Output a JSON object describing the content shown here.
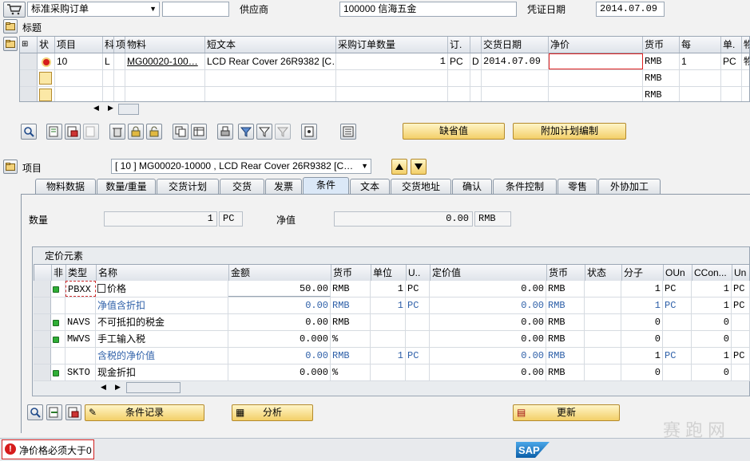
{
  "header": {
    "doc_type": "标准采购订单",
    "supplier_label": "供应商",
    "supplier_value": "100000 信海五金",
    "doc_date_label": "凭证日期",
    "doc_date_value": "2014.07.09"
  },
  "sections": {
    "header_label": "标题",
    "item_label": "项目"
  },
  "items_table": {
    "columns": [
      "状",
      "项目",
      "科",
      "项",
      "物料",
      "短文本",
      "采购订单数量",
      "订.",
      "",
      "交货日期",
      "净价",
      "货币",
      "每",
      "单.",
      "物"
    ],
    "row1": {
      "item": "10",
      "acct": "L",
      "material": "MG00020-100…",
      "short_text": "LCD Rear Cover 26R9382 [C…",
      "qty": "1",
      "unit": "PC",
      "cat": "D",
      "date": "2014.07.09",
      "price": "",
      "currency": "RMB",
      "per": "1",
      "order_unit": "PC",
      "mat_grp": "物"
    },
    "row2": {
      "currency": "RMB"
    },
    "row3": {
      "currency": "RMB"
    }
  },
  "item_buttons": {
    "default_values": "缺省值",
    "additional_planning": "附加计划编制"
  },
  "item_selector": {
    "value": "[ 10 ] MG00020-10000 , LCD Rear Cover 26R9382 [C…"
  },
  "tabs": [
    "物料数据",
    "数量/重量",
    "交货计划",
    "交货",
    "发票",
    "条件",
    "文本",
    "交货地址",
    "确认",
    "条件控制",
    "零售",
    "外协加工"
  ],
  "active_tab": "条件",
  "conditions": {
    "qty_label": "数量",
    "qty_value": "1",
    "qty_unit": "PC",
    "net_label": "净值",
    "net_value": "0.00",
    "net_currency": "RMB",
    "panel_title": "定价元素",
    "columns": [
      "非",
      "类型",
      "名称",
      "金额",
      "货币",
      "单位",
      "U..",
      "定价值",
      "货币",
      "状态",
      "分子",
      "OUn",
      "CCon...",
      "Un"
    ],
    "rows": [
      {
        "type": "PBXX",
        "name": "价格",
        "amount": "50.00",
        "curr": "RMB",
        "per": "1",
        "uom": "PC",
        "cond_value": "0.00",
        "curr2": "RMB",
        "num": "1",
        "oun": "PC",
        "ccon": "1",
        "un": "PC"
      },
      {
        "type": "",
        "name": "净值含折扣",
        "amount": "0.00",
        "curr": "RMB",
        "per": "1",
        "uom": "PC",
        "cond_value": "0.00",
        "curr2": "RMB",
        "num": "1",
        "oun": "PC",
        "ccon": "1",
        "un": "PC"
      },
      {
        "type": "NAVS",
        "name": "不可抵扣的税金",
        "amount": "0.00",
        "curr": "RMB",
        "per": "",
        "uom": "",
        "cond_value": "0.00",
        "curr2": "RMB",
        "num": "0",
        "oun": "",
        "ccon": "0",
        "un": ""
      },
      {
        "type": "MWVS",
        "name": "手工输入税",
        "amount": "0.000",
        "curr": "%",
        "per": "",
        "uom": "",
        "cond_value": "0.00",
        "curr2": "RMB",
        "num": "0",
        "oun": "",
        "ccon": "0",
        "un": ""
      },
      {
        "type": "",
        "name": "含税的净价值",
        "amount": "0.00",
        "curr": "RMB",
        "per": "1",
        "uom": "PC",
        "cond_value": "0.00",
        "curr2": "RMB",
        "num": "1",
        "oun": "PC",
        "ccon": "1",
        "un": "PC"
      },
      {
        "type": "SKTO",
        "name": "现金折扣",
        "amount": "0.000",
        "curr": "%",
        "per": "",
        "uom": "",
        "cond_value": "0.00",
        "curr2": "RMB",
        "num": "0",
        "oun": "",
        "ccon": "0",
        "un": ""
      }
    ],
    "btn_records": "条件记录",
    "btn_analysis": "分析",
    "btn_update": "更新"
  },
  "status": {
    "message": "净价格必须大于0"
  },
  "watermark": "赛跑网"
}
